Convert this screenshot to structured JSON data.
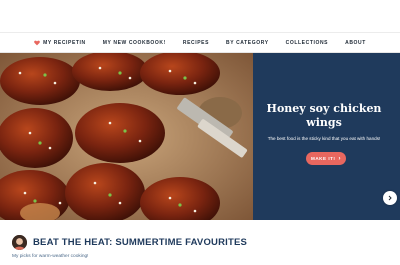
{
  "nav": {
    "items": [
      {
        "label": "MY RECIPETIN",
        "icon": "heart-icon"
      },
      {
        "label": "MY NEW COOKBOOK!"
      },
      {
        "label": "RECIPES"
      },
      {
        "label": "BY CATEGORY"
      },
      {
        "label": "COLLECTIONS"
      },
      {
        "label": "ABOUT"
      }
    ],
    "heart_color": "#e8675f"
  },
  "hero": {
    "title": "Honey soy chicken wings",
    "subtitle": "The best food is the sticky kind that you eat with hands!",
    "button_label": "MAKE IT!",
    "button_icon": "chevron-right-icon",
    "next_icon": "chevron-right-icon",
    "panel_color": "#1f3a5c",
    "button_color": "#e8675f"
  },
  "section": {
    "title": "BEAT THE HEAT: SUMMERTIME FAVOURITES",
    "subtitle": "My picks for warm-weather cooking!"
  }
}
